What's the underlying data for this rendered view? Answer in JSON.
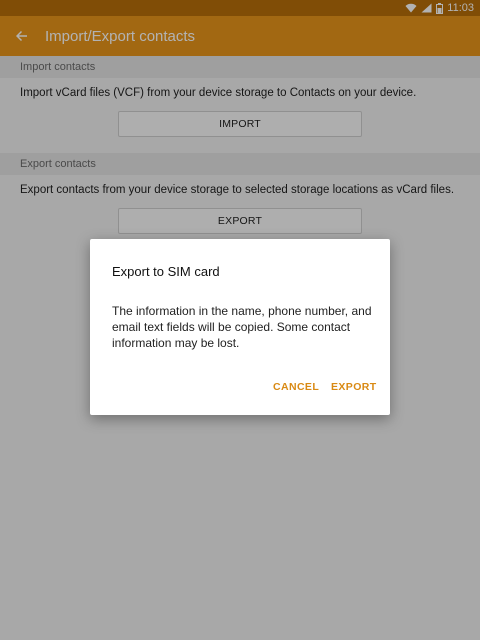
{
  "status_bar": {
    "time": "11:03",
    "icons": [
      "wifi-icon",
      "signal-icon",
      "battery-icon"
    ]
  },
  "app_bar": {
    "title": "Import/Export contacts",
    "back_icon": "arrow-left-icon"
  },
  "import_section": {
    "header": "Import contacts",
    "description": "Import vCard files (VCF) from your device storage to Contacts on your device.",
    "button_label": "IMPORT"
  },
  "export_section": {
    "header": "Export contacts",
    "description": "Export contacts from your device storage to selected storage locations as vCard files.",
    "button_label": "EXPORT"
  },
  "dialog": {
    "title": "Export to SIM card",
    "message": "The information in the name, phone number, and email text fields will be copied. Some contact information may be lost.",
    "cancel_label": "CANCEL",
    "confirm_label": "EXPORT"
  },
  "colors": {
    "app_bar": "#e9951a",
    "status_bar": "#b86f09",
    "accent_text": "#d98a14"
  }
}
